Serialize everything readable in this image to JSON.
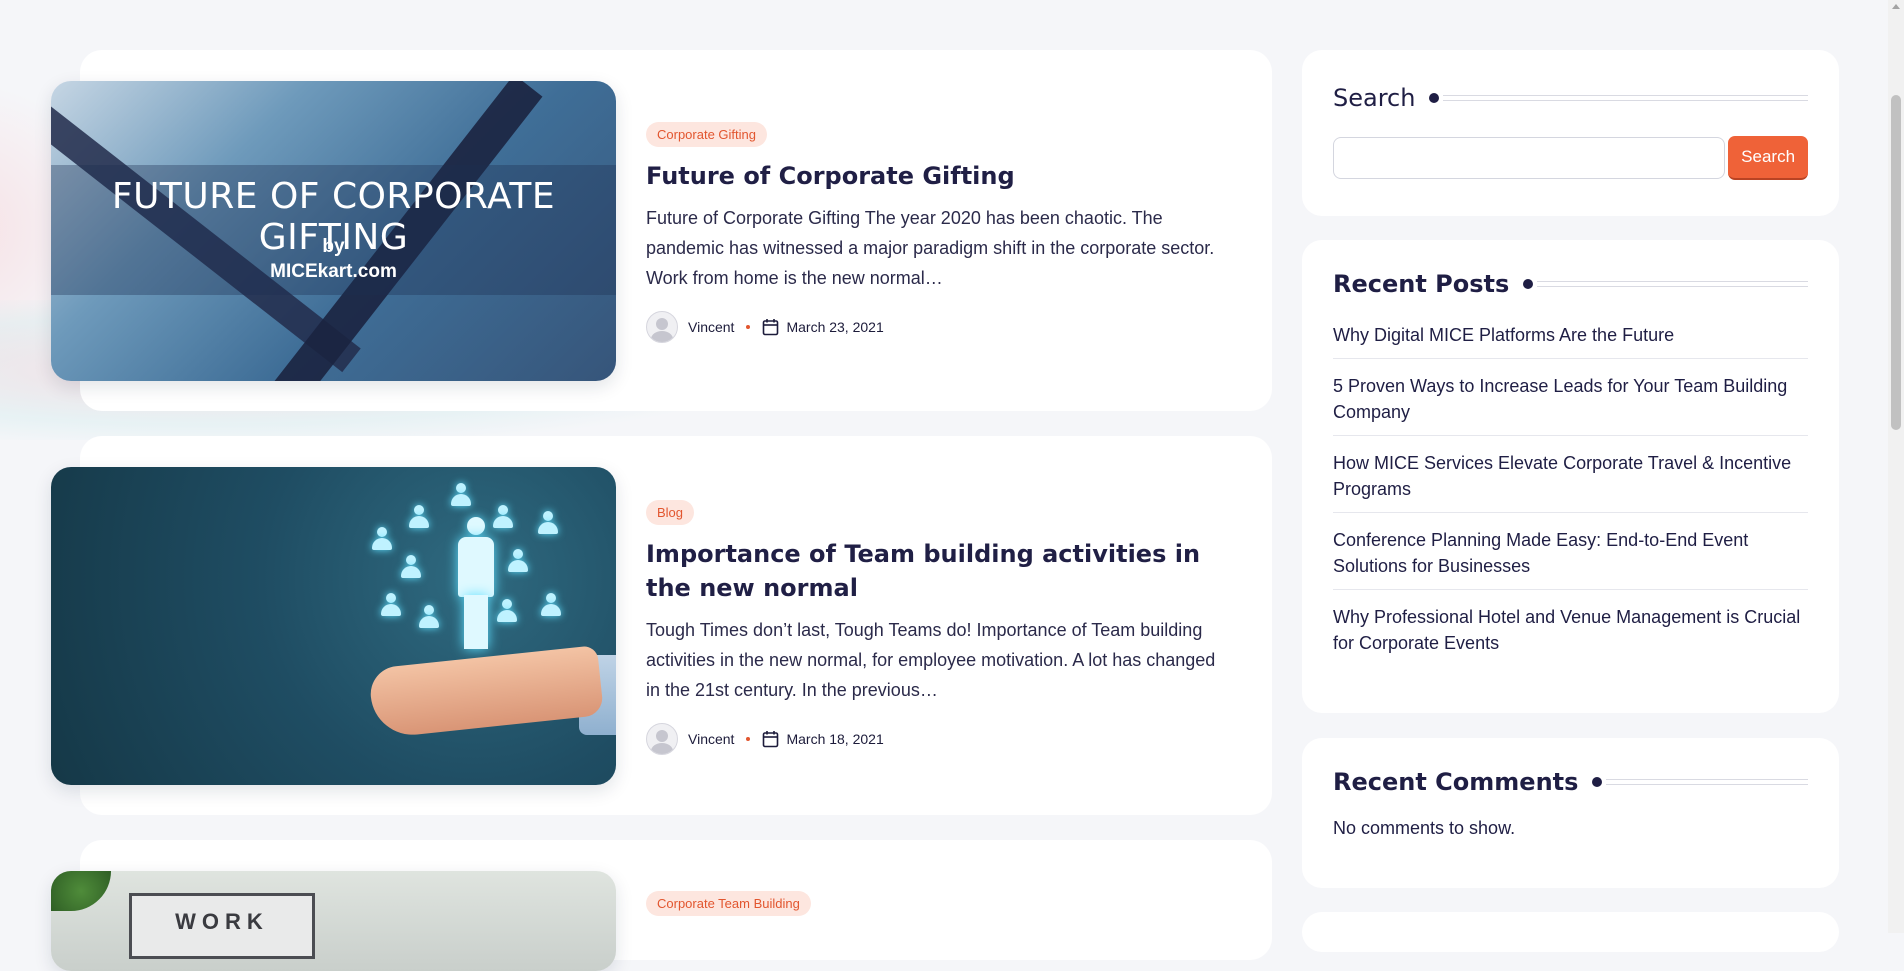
{
  "posts": [
    {
      "category": "Corporate Gifting",
      "title": "Future of Corporate Gifting",
      "excerpt": "Future of Corporate Gifting   The year 2020 has been chaotic. The pandemic has witnessed a major paradigm shift in the corporate sector. Work from home is the new normal…",
      "author": "Vincent",
      "date": "March 23, 2021",
      "image_text": {
        "headline": "FUTURE OF CORPORATE GIFTING",
        "by": "by",
        "site": "MICEkart.com"
      }
    },
    {
      "category": "Blog",
      "title": "Importance of Team building activities in the new normal",
      "excerpt": "Tough Times don’t last, Tough Teams do! Importance of Team building activities in the new normal, for employee motivation.  A lot has changed in the 21st century. In the previous…",
      "author": "Vincent",
      "date": "March 18, 2021"
    },
    {
      "category": "Corporate Team Building",
      "image_text": {
        "sign": "WORK"
      }
    }
  ],
  "sidebar": {
    "search": {
      "title": "Search",
      "button_label": "Search",
      "input_value": ""
    },
    "recent_posts": {
      "title": "Recent Posts",
      "items": [
        "Why Digital MICE Platforms Are the Future",
        "5 Proven Ways to Increase Leads for Your Team Building Company",
        "How MICE Services Elevate Corporate Travel & Incentive Programs",
        "Conference Planning Made Easy: End-to-End Event Solutions for Businesses",
        "Why Professional Hotel and Venue Management is Crucial for Corporate Events"
      ]
    },
    "recent_comments": {
      "title": "Recent Comments",
      "empty_text": "No comments to show."
    }
  },
  "colors": {
    "accent": "#ef6238",
    "badge_bg": "#fde6df",
    "heading": "#1f1e44",
    "page_bg": "#f5f6f9"
  }
}
